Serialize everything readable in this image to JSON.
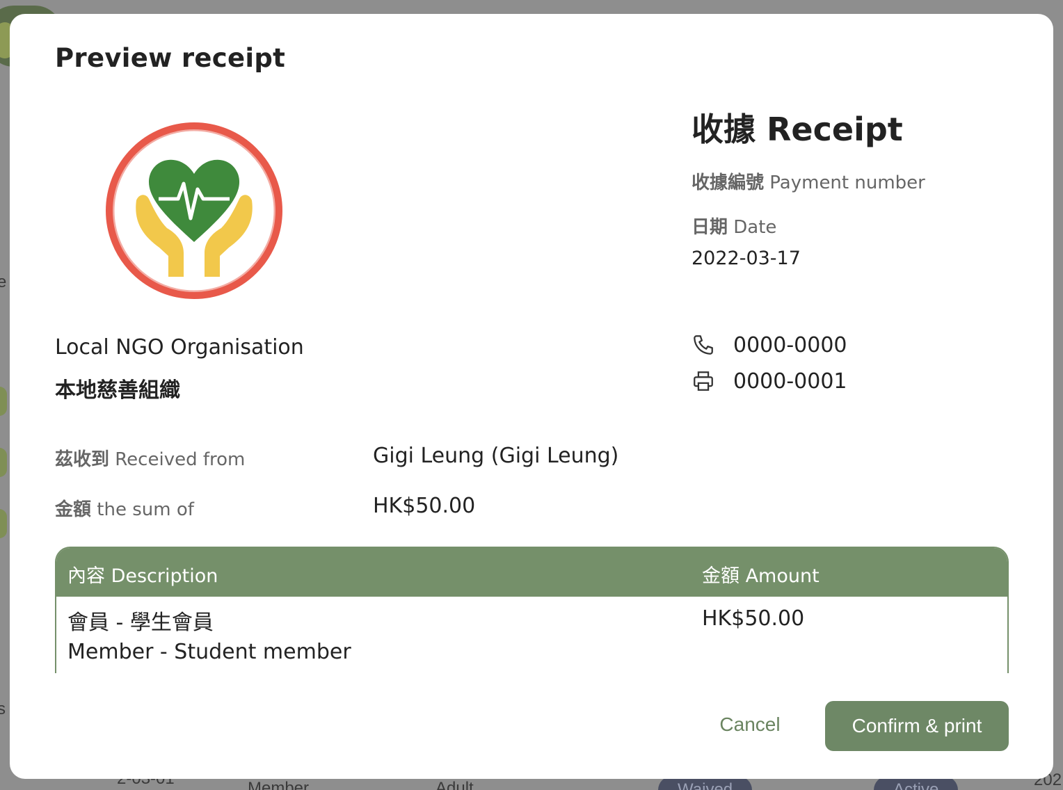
{
  "modal": {
    "title": "Preview receipt"
  },
  "organisation": {
    "name_en": "Local NGO Organisation",
    "name_zh": "本地慈善組織",
    "phone": "0000-0000",
    "fax": "0000-0001"
  },
  "receipt": {
    "title": "收據 Receipt",
    "payment_number_label_zh": "收據編號",
    "payment_number_label_en": "Payment number",
    "date_label_zh": "日期",
    "date_label_en": "Date",
    "date_value": "2022-03-17",
    "received_from_label_zh": "茲收到",
    "received_from_label_en": "Received from",
    "received_from_value": "Gigi Leung (Gigi Leung)",
    "sum_label_zh": "金額",
    "sum_label_en": "the sum of",
    "sum_value": "HK$50.00"
  },
  "table": {
    "header_desc": "內容 Description",
    "header_amount": "金額 Amount",
    "rows": [
      {
        "desc_zh": "會員 - 學生會員",
        "desc_en": "Member - Student member",
        "amount": "HK$50.00"
      }
    ]
  },
  "actions": {
    "cancel_label": "Cancel",
    "confirm_label": "Confirm & print"
  },
  "background": {
    "fragments": [
      "e",
      "s",
      "2-03-01",
      "Member",
      "Adult",
      "Waived",
      "Active",
      "202"
    ]
  },
  "colors": {
    "accent": "#75906a",
    "logo_ring": "#e8594a",
    "logo_heart": "#3f8a3c",
    "logo_hands": "#f2c84b"
  },
  "icons": {
    "phone": "phone-icon",
    "fax": "printer-icon"
  }
}
